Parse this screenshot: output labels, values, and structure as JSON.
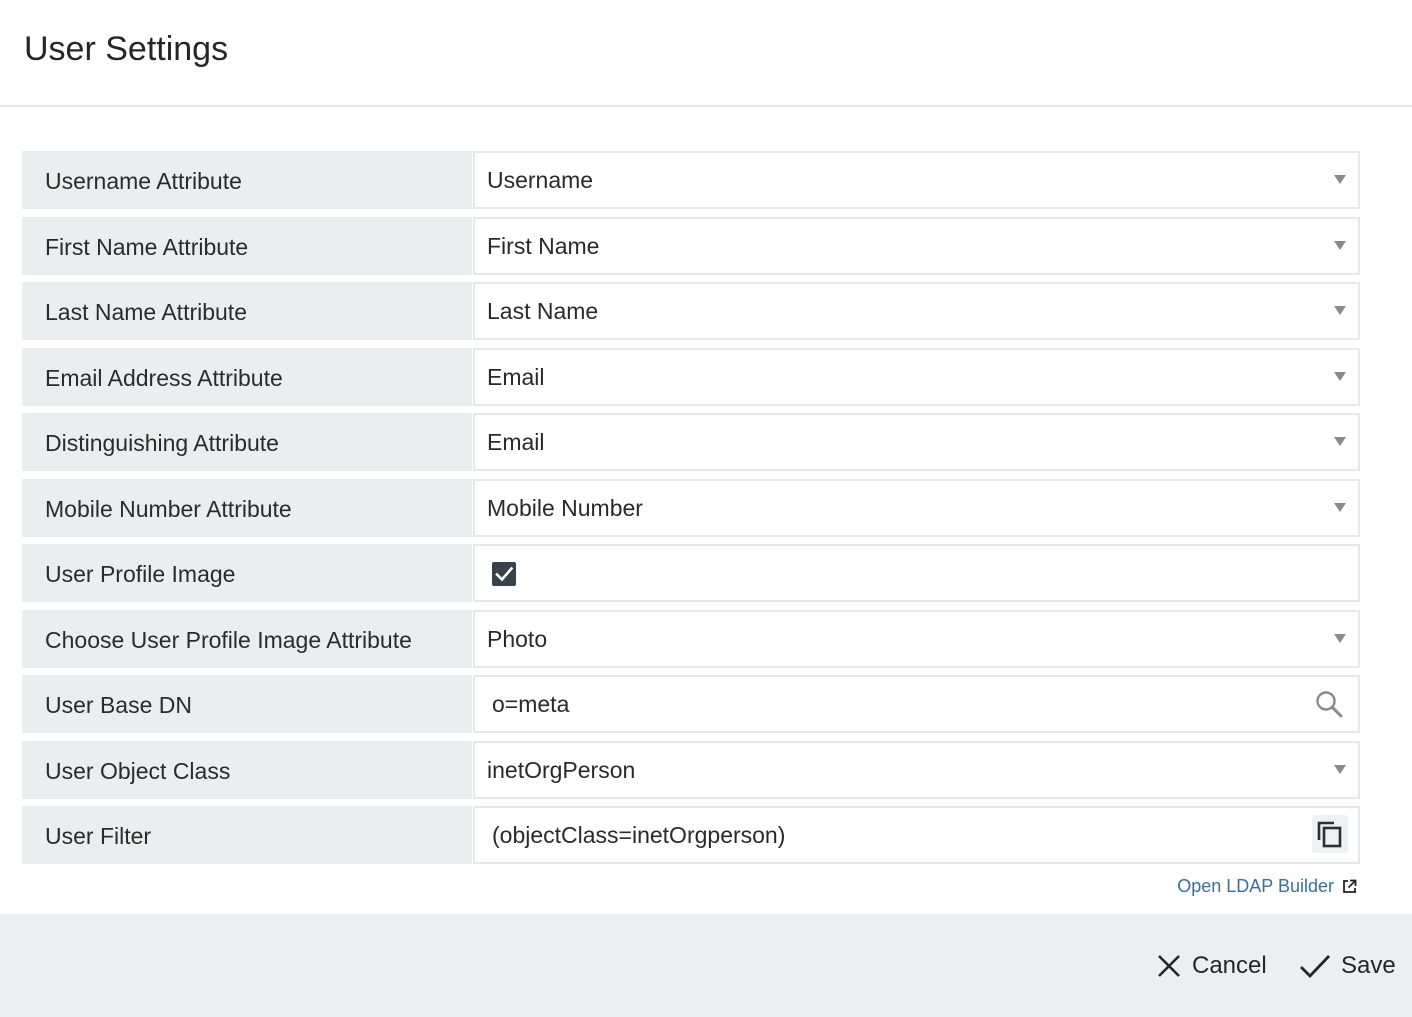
{
  "dialog": {
    "title": "User Settings"
  },
  "fields": {
    "username": {
      "label": "Username Attribute",
      "value": "Username"
    },
    "first_name": {
      "label": "First Name Attribute",
      "value": "First Name"
    },
    "last_name": {
      "label": "Last Name Attribute",
      "value": "Last Name"
    },
    "email": {
      "label": "Email Address Attribute",
      "value": "Email"
    },
    "distinguishing": {
      "label": "Distinguishing Attribute",
      "value": "Email"
    },
    "mobile": {
      "label": "Mobile Number Attribute",
      "value": "Mobile Number"
    },
    "profile_image": {
      "label": "User Profile Image",
      "checked": true
    },
    "profile_image_attr": {
      "label": "Choose User Profile Image Attribute",
      "value": "Photo"
    },
    "base_dn": {
      "label": "User Base DN",
      "value": "o=meta"
    },
    "object_class": {
      "label": "User Object Class",
      "value": "inetOrgPerson"
    },
    "filter": {
      "label": "User Filter",
      "value": "(objectClass=inetOrgperson)"
    }
  },
  "links": {
    "ldap_builder": "Open LDAP Builder"
  },
  "footer": {
    "cancel_label": "Cancel",
    "save_label": "Save"
  },
  "icons": {
    "dropdown": "chevron-down-icon",
    "search": "search-icon",
    "copy": "copy-icon",
    "external": "external-link-icon",
    "cancel": "close-icon",
    "save": "check-icon"
  }
}
